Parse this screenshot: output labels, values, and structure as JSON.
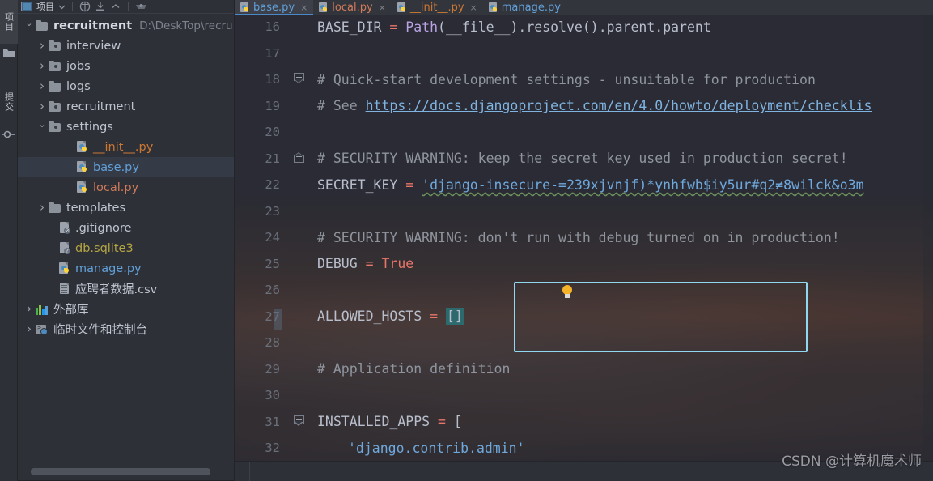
{
  "rail": {
    "items": [
      {
        "label": "项目",
        "icon": "project-icon"
      },
      {
        "label": "提交",
        "icon": "commit-icon"
      }
    ]
  },
  "panel": {
    "toolbar": {
      "title": "项目",
      "icons": [
        "project-view-icon",
        "chevron-down-icon",
        "locate-icon",
        "collapse-all-icon",
        "expand-icon",
        "settings-icon"
      ]
    },
    "tree": [
      {
        "indent": 0,
        "chevron": "open",
        "icon": "folder-icon",
        "name": "recruitment",
        "bold": true,
        "color": "gry",
        "path": "D:\\DeskTop\\recru"
      },
      {
        "indent": 1,
        "chevron": "closed",
        "icon": "module-folder-icon",
        "name": "interview",
        "bold": false,
        "color": "gry",
        "path": ""
      },
      {
        "indent": 1,
        "chevron": "closed",
        "icon": "module-folder-icon",
        "name": "jobs",
        "bold": false,
        "color": "gry",
        "path": ""
      },
      {
        "indent": 1,
        "chevron": "closed",
        "icon": "folder-icon",
        "name": "logs",
        "bold": false,
        "color": "gry",
        "path": ""
      },
      {
        "indent": 1,
        "chevron": "closed",
        "icon": "module-folder-icon",
        "name": "recruitment",
        "bold": false,
        "color": "gry",
        "path": ""
      },
      {
        "indent": 1,
        "chevron": "open",
        "icon": "module-folder-icon",
        "name": "settings",
        "bold": false,
        "color": "gry",
        "path": ""
      },
      {
        "indent": 2,
        "chevron": "none",
        "icon": "python-file-icon",
        "name": "__init__.py",
        "bold": false,
        "color": "pyo",
        "path": ""
      },
      {
        "indent": 2,
        "chevron": "none",
        "icon": "python-file-icon",
        "name": "base.py",
        "bold": false,
        "color": "py",
        "path": "",
        "selected": true
      },
      {
        "indent": 2,
        "chevron": "none",
        "icon": "python-file-icon",
        "name": "local.py",
        "bold": false,
        "color": "pyr",
        "path": ""
      },
      {
        "indent": 1,
        "chevron": "closed",
        "icon": "folder-icon",
        "name": "templates",
        "bold": false,
        "color": "gry",
        "path": ""
      },
      {
        "indent": 2,
        "chevron": "none",
        "icon": "gitignore-file-icon",
        "name": ".gitignore",
        "bold": false,
        "color": "gry",
        "path": ""
      },
      {
        "indent": 2,
        "chevron": "none",
        "icon": "sqlite-file-icon",
        "name": "db.sqlite3",
        "bold": false,
        "color": "yel",
        "path": ""
      },
      {
        "indent": 2,
        "chevron": "none",
        "icon": "python-file-icon",
        "name": "manage.py",
        "bold": false,
        "color": "py",
        "path": ""
      },
      {
        "indent": 2,
        "chevron": "none",
        "icon": "csv-file-icon",
        "name": "应聘者数据.csv",
        "bold": false,
        "color": "gry",
        "path": ""
      },
      {
        "indent": 0,
        "chevron": "closed",
        "icon": "external-libraries-icon",
        "name": "外部库",
        "bold": false,
        "color": "gry",
        "path": ""
      },
      {
        "indent": 0,
        "chevron": "closed",
        "icon": "scratches-console-icon",
        "name": "临时文件和控制台",
        "bold": false,
        "color": "gry",
        "path": ""
      }
    ],
    "hscrollbar": "horizontal-scrollbar"
  },
  "editor": {
    "tabs": [
      {
        "label": "base.py",
        "color": "py",
        "active": true,
        "close": "×"
      },
      {
        "label": "local.py",
        "color": "pyr",
        "active": false,
        "close": "×"
      },
      {
        "label": "__init__.py",
        "color": "pyo",
        "active": false,
        "close": "×"
      },
      {
        "label": "manage.py",
        "color": "py",
        "active": false,
        "close": "×"
      }
    ],
    "lines": [
      {
        "num": "16",
        "fold": "none",
        "vline": false
      },
      {
        "num": "17",
        "fold": "none",
        "vline": false
      },
      {
        "num": "18",
        "fold": "down",
        "vline": true
      },
      {
        "num": "19",
        "fold": "none",
        "vline": true
      },
      {
        "num": "20",
        "fold": "none",
        "vline": false
      },
      {
        "num": "21",
        "fold": "up",
        "vline": true
      },
      {
        "num": "22",
        "fold": "none",
        "vline": true
      },
      {
        "num": "23",
        "fold": "none",
        "vline": false
      },
      {
        "num": "24",
        "fold": "none",
        "vline": false
      },
      {
        "num": "25",
        "fold": "none",
        "vline": false
      },
      {
        "num": "26",
        "fold": "none",
        "vline": false
      },
      {
        "num": "27",
        "fold": "none",
        "vline": false
      },
      {
        "num": "28",
        "fold": "none",
        "vline": false
      },
      {
        "num": "29",
        "fold": "none",
        "vline": false
      },
      {
        "num": "30",
        "fold": "none",
        "vline": false
      },
      {
        "num": "31",
        "fold": "down",
        "vline": true
      },
      {
        "num": "32",
        "fold": "none",
        "vline": true
      }
    ],
    "code": {
      "l16_a": "BASE_DIR",
      "l16_op": "=",
      "l16_fn": "Path",
      "l16_b": "(__file__).resolve().parent.parent",
      "l18": "# Quick-start development settings - unsuitable for production",
      "l19_a": "# See ",
      "l19_url": "https://docs.djangoproject.com/en/4.0/howto/deployment/checklis",
      "l21": "# SECURITY WARNING: keep the secret key used in production secret!",
      "l22_a": "SECRET_KEY",
      "l22_op": "=",
      "l22_str": "'django-insecure-=239xjvnjf)*ynhfwb$iy5ur#q2≠8wilck&o3m",
      "l24": "# SECURITY WARNING: don't run with debug turned on in production!",
      "l25_a": "DEBUG",
      "l25_op": "=",
      "l25_kw": "True",
      "l27_a": "ALLOWED_HOSTS",
      "l27_op": "=",
      "l27_val": "[]",
      "l29": "# Application definition",
      "l31_a": "INSTALLED_APPS",
      "l31_op": "=",
      "l31_b": "[",
      "l32": "'django.contrib.admin'"
    },
    "highlight_box_color": "#8fd8ef",
    "bulb_icon": "intention-bulb-icon",
    "selection_color": "#2d6a6e"
  },
  "watermark": "CSDN @计算机魔术师"
}
